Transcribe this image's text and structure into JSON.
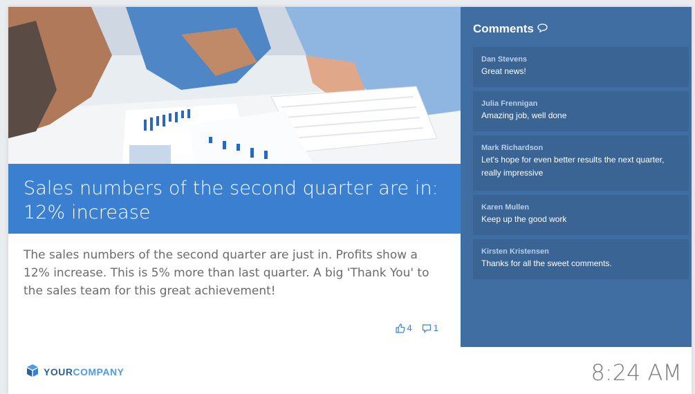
{
  "headline": "Sales numbers of the second quarter are in: 12% increase",
  "body": "The sales numbers of the second quarter are just in. Profits show a 12% increase. This is 5% more than last quarter. A big 'Thank You' to the sales team for this great achievement!",
  "reactions": {
    "likes": "4",
    "comments": "1"
  },
  "comments_panel": {
    "title": "Comments",
    "items": [
      {
        "author": "Dan Stevens",
        "message": "Great news!"
      },
      {
        "author": "Julia Frennigan",
        "message": "Amazing job, well done"
      },
      {
        "author": "Mark Richardson",
        "message": "Let's hope for even better results the next quarter, really impressive"
      },
      {
        "author": "Karen Mullen",
        "message": "Keep up the good work"
      },
      {
        "author": "Kirsten Kristensen",
        "message": "Thanks for all the sweet comments."
      }
    ]
  },
  "footer": {
    "logo_bold": "YOUR",
    "logo_light": "COMPANY",
    "time": "8:24 AM"
  },
  "colors": {
    "headline_bg": "#3b7fd1",
    "panel_bg": "#406ea3",
    "card_bg": "#3a6493",
    "logo_dark": "#2f5f95",
    "logo_light": "#4d9be0"
  },
  "icons": [
    "thumbs-up-icon",
    "comment-bubble-icon",
    "speech-bubble-icon",
    "company-logo-icon"
  ]
}
